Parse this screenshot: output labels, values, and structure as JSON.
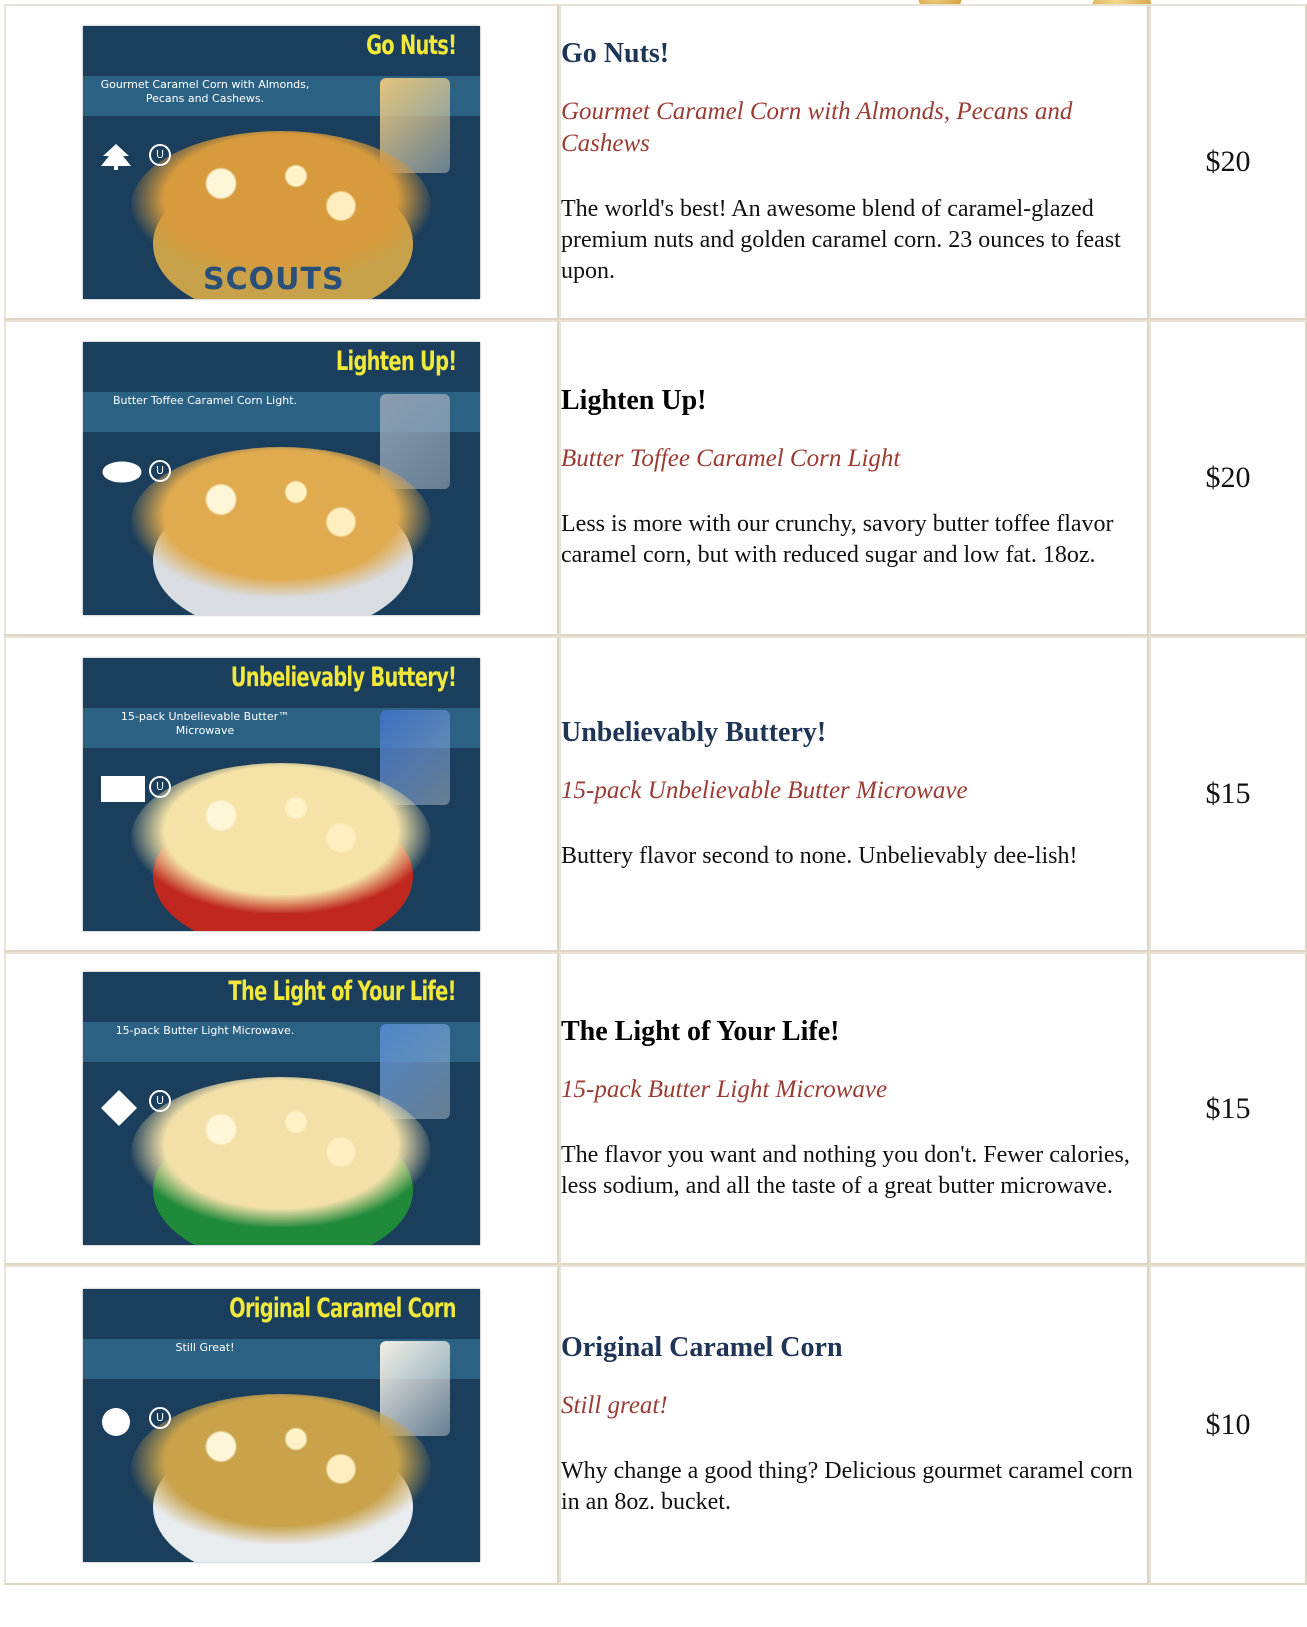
{
  "products": [
    {
      "name": "Go Nuts!",
      "name_color": "blue",
      "tagline": "Gourmet Caramel Corn with Almonds, Pecans and Cashews",
      "description": "The world's best! An awesome blend of caramel-glazed premium nuts and golden caramel corn. 23 ounces to feast upon.",
      "price": "$20",
      "image": {
        "title": "Go Nuts!",
        "subtitle": "Gourmet Caramel Corn with Almonds, Pecans and Cashews.",
        "symbol": "tree-icon",
        "bottom_text": "SCOUTS",
        "popcorn_color": "#d79a3c",
        "bowl_color": "#c8a24a",
        "package_color": "#e4c47a"
      }
    },
    {
      "name": "Lighten Up!",
      "name_color": "black",
      "tagline": "Butter Toffee Caramel Corn Light",
      "description": "Less is more with our crunchy, savory butter toffee flavor caramel corn, but with reduced sugar and low fat. 18oz.",
      "price": "$20",
      "image": {
        "title": "Lighten Up!",
        "subtitle": "Butter Toffee Caramel Corn Light.",
        "symbol": "oval-icon",
        "bottom_text": "",
        "popcorn_color": "#e0aa4e",
        "bowl_color": "#d9dde2",
        "package_color": "#8a9bb0"
      }
    },
    {
      "name": "Unbelievably Buttery!",
      "name_color": "blue",
      "tagline": "15-pack Unbelievable Butter Microwave",
      "description": "Buttery flavor second to none. Unbelievably dee-lish!",
      "price": "$15",
      "image": {
        "title": "Unbelievably Buttery!",
        "subtitle": "15-pack Unbelievable Butter™ Microwave",
        "symbol": "rectangle-icon",
        "bottom_text": "",
        "popcorn_color": "#f4e2a6",
        "bowl_color": "#c0281f",
        "package_color": "#3c6fc2"
      }
    },
    {
      "name": "The Light of Your Life!",
      "name_color": "black",
      "tagline": "15-pack Butter Light Microwave",
      "description": "The flavor you want and nothing you don't. Fewer calories, less sodium, and all the taste of a great butter microwave.",
      "price": "$15",
      "image": {
        "title": "The Light of Your Life!",
        "subtitle": "15-pack Butter Light Microwave.",
        "symbol": "diamond-icon",
        "bottom_text": "",
        "popcorn_color": "#f2e0a8",
        "bowl_color": "#1f8a3a",
        "package_color": "#4f86c9"
      }
    },
    {
      "name": "Original Caramel Corn",
      "name_color": "blue",
      "tagline": "Still great!",
      "description": "Why change a good thing? Delicious gourmet caramel corn in an 8oz. bucket.",
      "price": "$10",
      "image": {
        "title": "Original Caramel Corn",
        "subtitle": "Still Great!",
        "symbol": "circle-icon",
        "bottom_text": "",
        "popcorn_color": "#c9a24a",
        "bowl_color": "#e9ecef",
        "package_color": "#f2efe6"
      }
    }
  ]
}
